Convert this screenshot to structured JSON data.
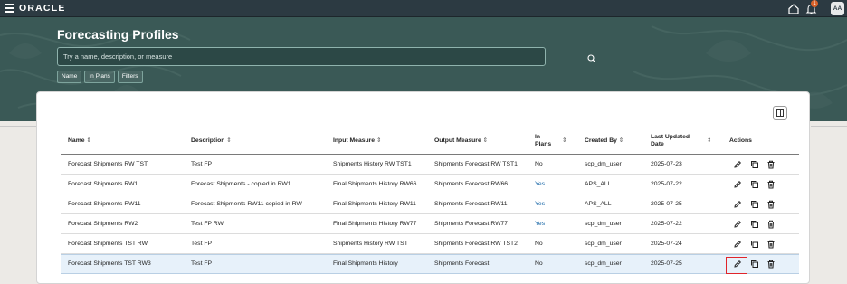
{
  "header": {
    "logo": "ORACLE",
    "notification_count": "1",
    "avatar_initials": "AA"
  },
  "page": {
    "title": "Forecasting Profiles",
    "search_placeholder": "Try a name, description, or measure",
    "filter_chips": [
      "Name",
      "In Plans",
      "Filters"
    ]
  },
  "table": {
    "columns": {
      "name": "Name",
      "description": "Description",
      "input_measure": "Input Measure",
      "output_measure": "Output Measure",
      "in_plans": "In Plans",
      "created_by": "Created By",
      "last_updated": "Last Updated Date",
      "actions": "Actions"
    },
    "rows": [
      {
        "name": "Forecast Shipments RW TST",
        "description": "Test FP",
        "input_measure": "Shipments History RW TST1",
        "output_measure": "Shipments Forecast RW TST1",
        "in_plans": "No",
        "created_by": "scp_dm_user",
        "last_updated": "2025-07-23"
      },
      {
        "name": "Forecast Shipments RW1",
        "description": "Forecast Shipments - copied in RW1",
        "input_measure": "Final Shipments History RW66",
        "output_measure": "Shipments Forecast RW66",
        "in_plans": "Yes",
        "created_by": "APS_ALL",
        "last_updated": "2025-07-22"
      },
      {
        "name": "Forecast Shipments RW11",
        "description": "Forecast Shipments RW11 copied in RW",
        "input_measure": "Final Shipments History RW11",
        "output_measure": "Shipments Forecast RW11",
        "in_plans": "Yes",
        "created_by": "APS_ALL",
        "last_updated": "2025-07-25"
      },
      {
        "name": "Forecast Shipments RW2",
        "description": "Test FP RW",
        "input_measure": "Final Shipments History RW77",
        "output_measure": "Shipments Forecast RW77",
        "in_plans": "Yes",
        "created_by": "scp_dm_user",
        "last_updated": "2025-07-22"
      },
      {
        "name": "Forecast Shipments TST RW",
        "description": "Test FP",
        "input_measure": "Shipments History RW TST",
        "output_measure": "Shipments Forecast RW TST2",
        "in_plans": "No",
        "created_by": "scp_dm_user",
        "last_updated": "2025-07-24"
      },
      {
        "name": "Forecast Shipments TST RW3",
        "description": "Test FP",
        "input_measure": "Final Shipments History",
        "output_measure": "Shipments Forecast",
        "in_plans": "No",
        "created_by": "scp_dm_user",
        "last_updated": "2025-07-25"
      }
    ]
  },
  "icons": {
    "menu": "hamburger-icon",
    "home": "home-icon",
    "notifications": "bell-icon",
    "search": "search-icon",
    "panel": "columns-panel-icon",
    "edit": "pencil-icon",
    "duplicate": "copy-icon",
    "delete": "trash-icon"
  },
  "colors": {
    "topbar": "#2c3a42",
    "hero": "#3a5956",
    "link": "#1565a6",
    "selected_row": "#e7f1fa",
    "focus_outline": "#e0242a",
    "badge": "#d8622a"
  }
}
